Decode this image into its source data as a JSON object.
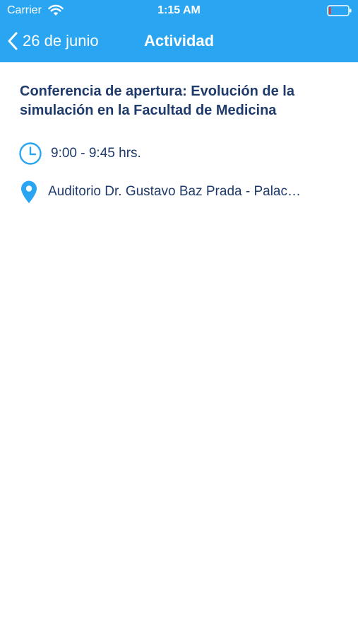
{
  "status_bar": {
    "carrier": "Carrier",
    "time": "1:15 AM",
    "background_color": "#2aa5f2"
  },
  "nav": {
    "back_label": "26 de junio",
    "title": "Actividad",
    "background_color": "#2aa5f2"
  },
  "activity": {
    "title": "Conferencia de apertura: Evolución de la simulación en la Facultad de Medicina",
    "time": "9:00 - 9:45 hrs.",
    "location": "Auditorio Dr. Gustavo Baz Prada - Palac…"
  },
  "icons": {
    "time": "clock-icon",
    "location": "location-pin-icon"
  }
}
